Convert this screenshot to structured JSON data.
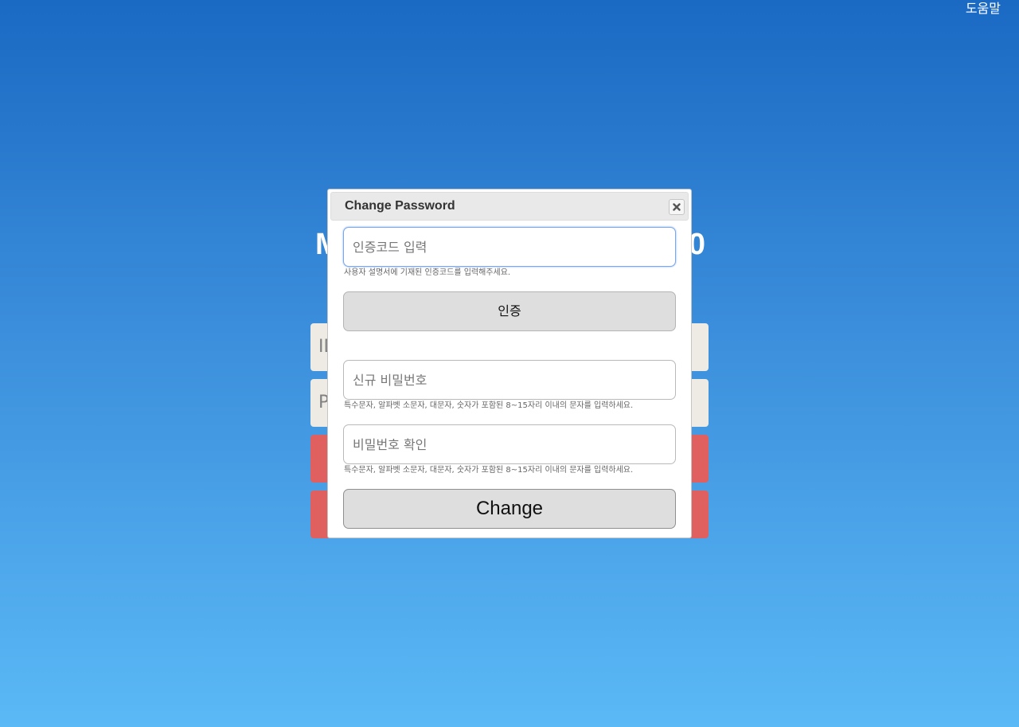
{
  "header": {
    "help_label": "도움말"
  },
  "background": {
    "title_first_char": "M",
    "title_last_char": "0",
    "id_field_partial": "ID",
    "pw_field_partial": "P"
  },
  "dialog": {
    "title": "Change Password",
    "close_icon": "close-icon",
    "auth_code": {
      "placeholder": "인증코드 입력",
      "value": "",
      "hint": "사용자 설명서에 기재된 인증코드를 입력해주세요."
    },
    "verify_label": "인증",
    "new_password": {
      "placeholder": "신규 비밀번호",
      "value": "",
      "hint": "특수문자, 알파벳 소문자, 대문자, 숫자가 포함된 8~15자리 이내의 문자를 입력하세요."
    },
    "confirm_password": {
      "placeholder": "비밀번호 확인",
      "value": "",
      "hint": "특수문자, 알파벳 소문자, 대문자, 숫자가 포함된 8~15자리 이내의 문자를 입력하세요."
    },
    "change_label": "Change"
  },
  "colors": {
    "bg_top": "#1a69c3",
    "bg_bottom": "#5bb9f6",
    "login_button": "#e06060",
    "dialog_button": "#dedede"
  }
}
